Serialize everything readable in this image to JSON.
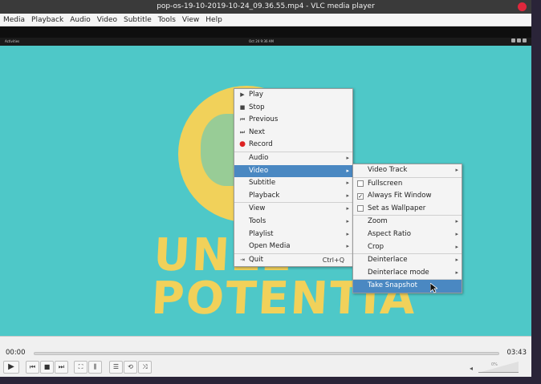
{
  "window": {
    "title": "pop-os-19-10-2019-10-24_09.36.55.mp4 - VLC media player"
  },
  "menubar": [
    "Media",
    "Playback",
    "Audio",
    "Video",
    "Subtitle",
    "Tools",
    "View",
    "Help"
  ],
  "video_topbar": {
    "left": "Activities",
    "center": "Oct 24  9:36 AM"
  },
  "poster": {
    "line1": "UNLE",
    "line2": "POTENTIA"
  },
  "context_menu": {
    "items": [
      {
        "label": "Play",
        "icon": "play-icon"
      },
      {
        "label": "Stop",
        "icon": "stop-icon"
      },
      {
        "label": "Previous",
        "icon": "previous-icon"
      },
      {
        "label": "Next",
        "icon": "next-icon"
      },
      {
        "label": "Record",
        "icon": "record-icon"
      },
      {
        "label": "Audio"
      },
      {
        "label": "Video"
      },
      {
        "label": "Subtitle"
      },
      {
        "label": "Playback"
      },
      {
        "label": "View"
      },
      {
        "label": "Tools"
      },
      {
        "label": "Playlist"
      },
      {
        "label": "Open Media"
      },
      {
        "label": "Quit",
        "shortcut": "Ctrl+Q",
        "icon": "quit-icon"
      }
    ]
  },
  "video_submenu": {
    "items": [
      {
        "label": "Video Track"
      },
      {
        "label": "Fullscreen",
        "checked": false
      },
      {
        "label": "Always Fit Window",
        "checked": true
      },
      {
        "label": "Set as Wallpaper",
        "checked": false
      },
      {
        "label": "Zoom"
      },
      {
        "label": "Aspect Ratio"
      },
      {
        "label": "Crop"
      },
      {
        "label": "Deinterlace"
      },
      {
        "label": "Deinterlace mode"
      },
      {
        "label": "Take Snapshot"
      }
    ]
  },
  "controls": {
    "elapsed": "00:00",
    "total": "03:43",
    "volume": "0%"
  },
  "colors": {
    "video_bg": "#4ec8c8",
    "poster_yellow": "#f1d15a",
    "highlight": "#4a88c2"
  }
}
